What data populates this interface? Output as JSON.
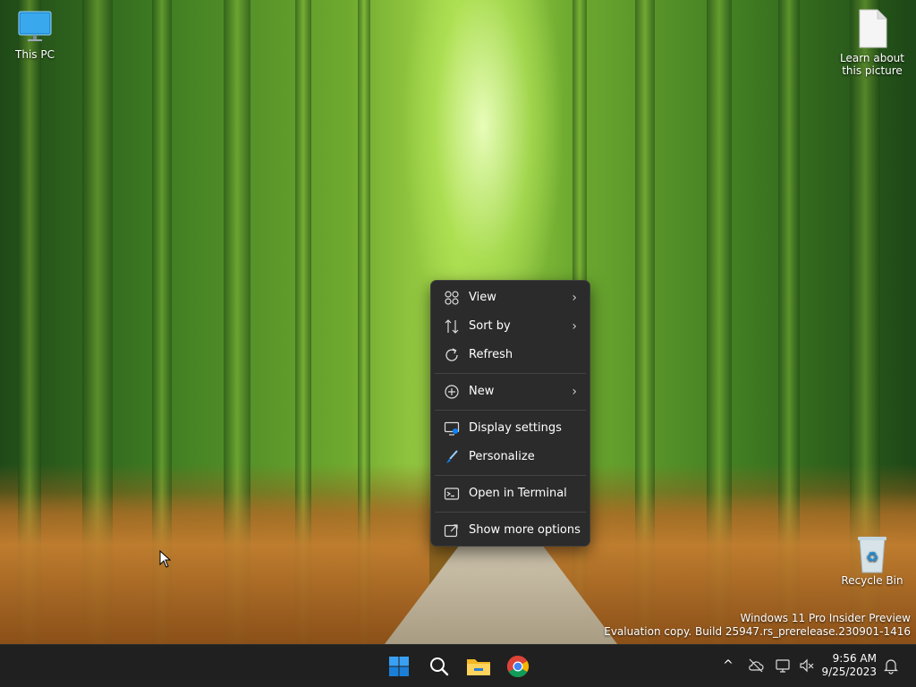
{
  "desktop": {
    "icons": [
      {
        "label": "This PC",
        "icon": "monitor-icon"
      },
      {
        "label": "Learn about this picture",
        "icon": "document-icon"
      },
      {
        "label": "Recycle Bin",
        "icon": "recycle-bin-icon"
      }
    ],
    "watermark": {
      "line1": "Windows 11 Pro Insider Preview",
      "line2": "Evaluation copy. Build 25947.rs_prerelease.230901-1416"
    }
  },
  "context_menu": {
    "items": [
      {
        "label": "View",
        "icon": "grid-icon",
        "submenu": true
      },
      {
        "label": "Sort by",
        "icon": "sort-icon",
        "submenu": true
      },
      {
        "label": "Refresh",
        "icon": "refresh-icon",
        "submenu": false
      },
      {
        "label": "New",
        "icon": "plus-circle-icon",
        "submenu": true
      },
      {
        "label": "Display settings",
        "icon": "display-icon",
        "submenu": false
      },
      {
        "label": "Personalize",
        "icon": "brush-icon",
        "submenu": false
      },
      {
        "label": "Open in Terminal",
        "icon": "terminal-icon",
        "submenu": false
      },
      {
        "label": "Show more options",
        "icon": "share-icon",
        "submenu": false
      }
    ],
    "chevron": "›"
  },
  "taskbar": {
    "apps": [
      {
        "name": "Start",
        "icon": "windows-logo-icon"
      },
      {
        "name": "Search",
        "icon": "search-icon"
      },
      {
        "name": "File Explorer",
        "icon": "folder-icon"
      },
      {
        "name": "Google Chrome",
        "icon": "chrome-icon"
      }
    ],
    "tray": {
      "chevron": "^",
      "time": "9:56 AM",
      "date": "9/25/2023"
    }
  },
  "colors": {
    "menu_bg": "#2b2b2b",
    "taskbar_bg": "#202020",
    "accent": "#0a84ff"
  }
}
